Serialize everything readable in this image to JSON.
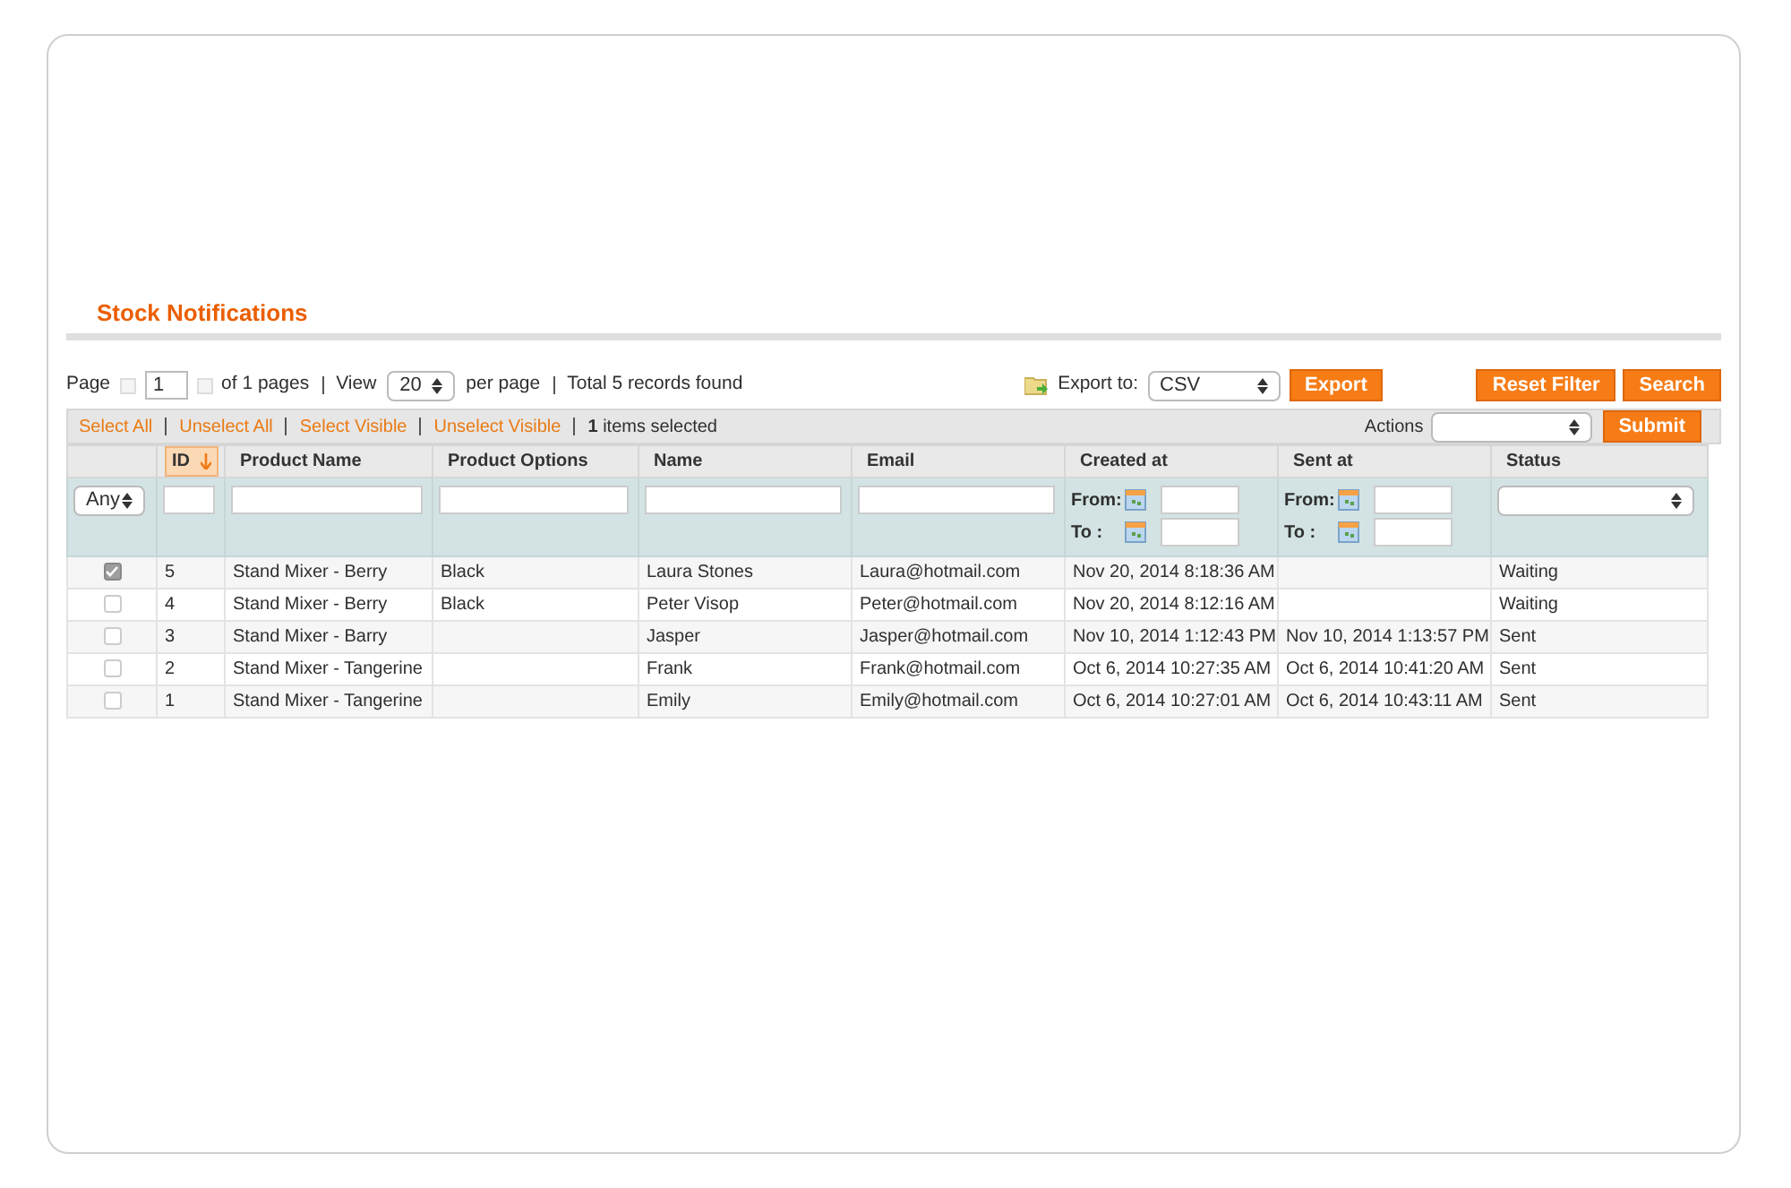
{
  "title": "Stock Notifications",
  "pager": {
    "page_label": "Page",
    "page": "1",
    "of_pages": "of 1 pages",
    "view_label": "View",
    "per_page": "20",
    "per_page_label": "per page",
    "total": "Total 5 records found"
  },
  "export": {
    "label": "Export to:",
    "format": "CSV",
    "button": "Export"
  },
  "buttons": [
    "Reset Filter",
    "Search"
  ],
  "massaction": {
    "links": [
      "Select All",
      "Unselect All",
      "Select Visible",
      "Unselect Visible"
    ],
    "count": "1",
    "count_label": "items selected",
    "actions_label": "Actions",
    "submit": "Submit"
  },
  "any_filter": "Any",
  "columns": [
    {
      "kind": "text",
      "label": "ID",
      "sorted": true
    },
    {
      "kind": "text",
      "label": "Product Name",
      "sorted": false
    },
    {
      "kind": "text",
      "label": "Product Options",
      "sorted": false
    },
    {
      "kind": "text",
      "label": "Name",
      "sorted": false
    },
    {
      "kind": "text",
      "label": "Email",
      "sorted": false
    },
    {
      "kind": "date",
      "label": "Created at",
      "sorted": false,
      "from": "From:",
      "to": "To :"
    },
    {
      "kind": "date",
      "label": "Sent at",
      "sorted": false,
      "from": "From:",
      "to": "To :"
    },
    {
      "kind": "select",
      "label": "Status",
      "sorted": false
    }
  ],
  "rows": [
    {
      "selected": true,
      "cells": [
        "5",
        "Stand Mixer - Berry",
        "Black",
        "Laura Stones",
        "Laura@hotmail.com",
        "Nov 20, 2014 8:18:36 AM",
        "",
        "Waiting"
      ]
    },
    {
      "selected": false,
      "cells": [
        "4",
        "Stand Mixer - Berry",
        "Black",
        "Peter Visop",
        "Peter@hotmail.com",
        "Nov 20, 2014 8:12:16 AM",
        "",
        "Waiting"
      ]
    },
    {
      "selected": false,
      "cells": [
        "3",
        "Stand Mixer - Barry",
        "",
        "Jasper",
        "Jasper@hotmail.com",
        "Nov 10, 2014 1:12:43 PM",
        "Nov 10, 2014 1:13:57 PM",
        "Sent"
      ]
    },
    {
      "selected": false,
      "cells": [
        "2",
        "Stand Mixer - Tangerine",
        "",
        "Frank",
        "Frank@hotmail.com",
        "Oct 6, 2014 10:27:35 AM",
        "Oct 6, 2014 10:41:20 AM",
        "Sent"
      ]
    },
    {
      "selected": false,
      "cells": [
        "1",
        "Stand Mixer - Tangerine",
        "",
        "Emily",
        "Emily@hotmail.com",
        "Oct 6, 2014 10:27:01 AM",
        "Oct 6, 2014 10:43:11 AM",
        "Sent"
      ]
    }
  ]
}
